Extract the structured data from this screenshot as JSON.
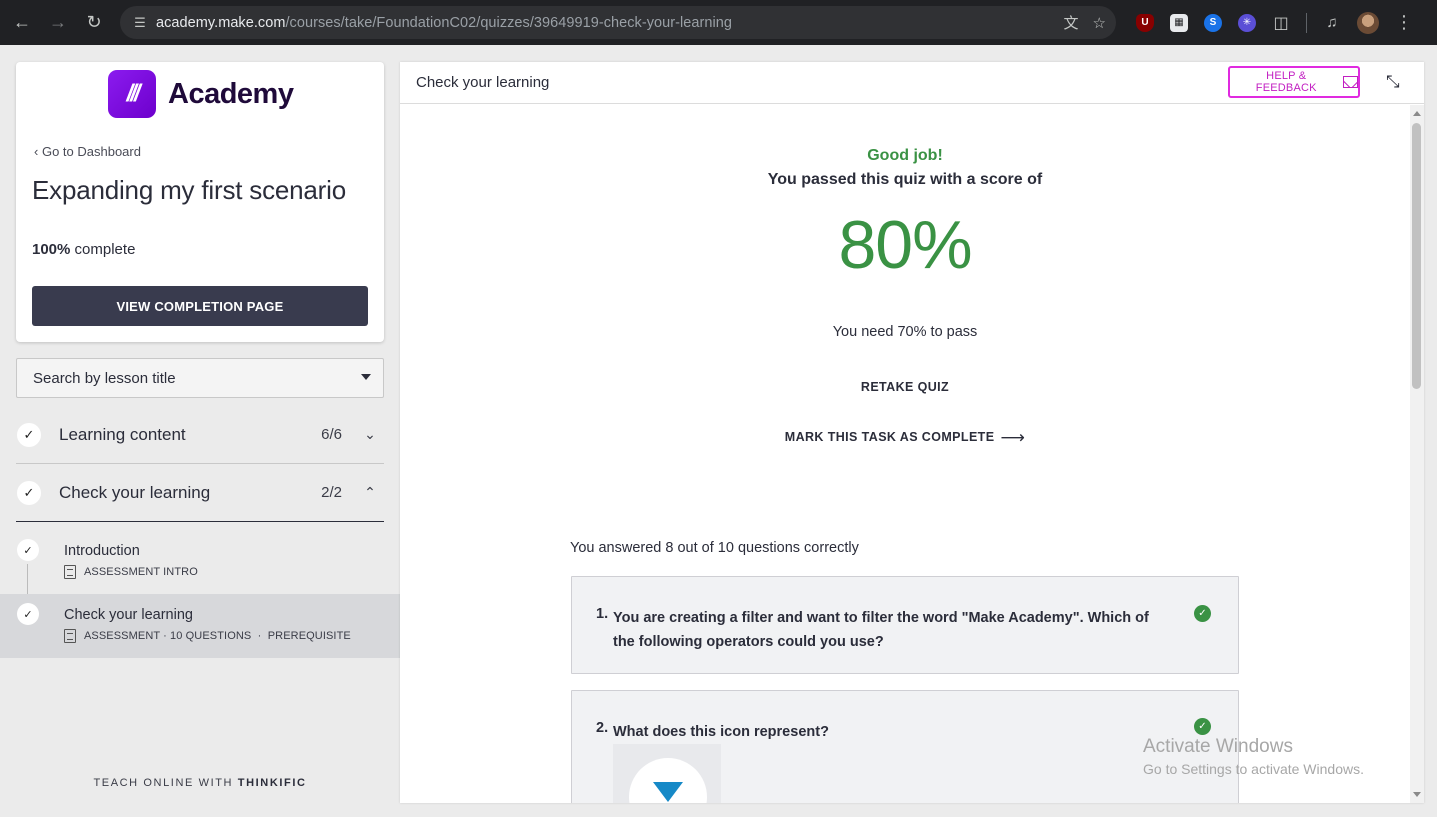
{
  "browser": {
    "url_host": "academy.make.com",
    "url_path": "/courses/take/FoundationC02/quizzes/39649919-check-your-learning"
  },
  "sidebar": {
    "logo_text": "Academy",
    "back_link": "Go to Dashboard",
    "course_title": "Expanding my first scenario",
    "progress_percent": "100%",
    "progress_suffix": "complete",
    "completion_button": "VIEW COMPLETION PAGE",
    "search_placeholder": "Search by lesson title",
    "chapters": [
      {
        "title": "Learning content",
        "count": "6/6",
        "expanded": false
      },
      {
        "title": "Check your learning",
        "count": "2/2",
        "expanded": true
      }
    ],
    "lessons": [
      {
        "title": "Introduction",
        "meta": "ASSESSMENT INTRO"
      },
      {
        "title": "Check your learning",
        "meta": "ASSESSMENT · 10 QUESTIONS  ·  PREREQUISITE"
      }
    ],
    "footer_prefix": "TEACH ONLINE WITH",
    "footer_brand": "THINKIFIC"
  },
  "main": {
    "title": "Check your learning",
    "help_button": "HELP & FEEDBACK",
    "good_job": "Good job!",
    "passed_text": "You passed this quiz with a score of",
    "score": "80%",
    "need_text": "You need 70% to pass",
    "retake": "RETAKE QUIZ",
    "mark_complete": "MARK THIS TASK AS COMPLETE",
    "answered": "You answered 8 out of 10 questions correctly",
    "questions": [
      {
        "number": "1.",
        "text": "You are creating a filter and want to filter the word \"Make Academy\". Which of the following operators could you use?",
        "correct": true
      },
      {
        "number": "2.",
        "text": "What does this icon represent?",
        "correct": true
      }
    ]
  },
  "watermark": {
    "line1": "Activate Windows",
    "line2": "Go to Settings to activate Windows."
  },
  "colors": {
    "accent_green": "#3a9244",
    "brand_purple": "#7a0fe0",
    "help_magenta": "#e02ae0",
    "button_dark": "#393b4e"
  }
}
